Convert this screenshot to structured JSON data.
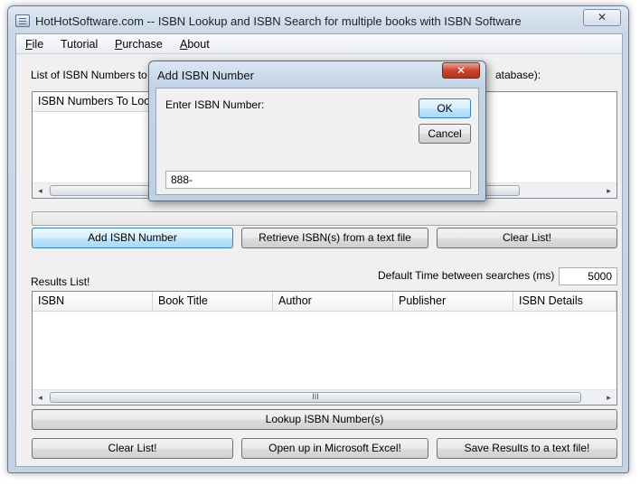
{
  "window": {
    "title": "HotHotSoftware.com -- ISBN Lookup and ISBN Search for multiple books with ISBN Software",
    "close_glyph": "✕"
  },
  "menu": {
    "file": {
      "u": "F",
      "rest": "ile"
    },
    "tutorial": "Tutorial",
    "purchase": {
      "u": "P",
      "rest": "urchase"
    },
    "about": {
      "u": "A",
      "rest": "bout"
    }
  },
  "isbn_list": {
    "label_visible": "List of ISBN Numbers to Look",
    "label_tail": "atabase):",
    "column_header": "ISBN Numbers To Look"
  },
  "buttons": {
    "add_isbn": "Add ISBN Number",
    "retrieve": "Retrieve ISBN(s) from a text file",
    "clear_top": "Clear List!",
    "lookup": "Lookup ISBN Number(s)",
    "clear_bottom": "Clear List!",
    "open_excel": "Open up in Microsoft Excel!",
    "save_results": "Save Results to a text file!"
  },
  "results": {
    "label": "Results List!",
    "delay_label": "Default Time between searches (ms)",
    "delay_value": "5000",
    "columns": [
      "ISBN",
      "Book Title",
      "Author",
      "Publisher",
      "ISBN Details"
    ]
  },
  "scroll": {
    "left": "◂",
    "right": "▸",
    "grip": "III"
  },
  "dialog": {
    "title": "Add ISBN Number",
    "close_glyph": "✕",
    "prompt": "Enter ISBN Number:",
    "ok": "OK",
    "cancel": "Cancel",
    "input_value": "888-"
  },
  "colors": {
    "accent_button": "#bee6fd",
    "window_frame": "#c4d3e4",
    "dialog_close": "#c8442c"
  }
}
